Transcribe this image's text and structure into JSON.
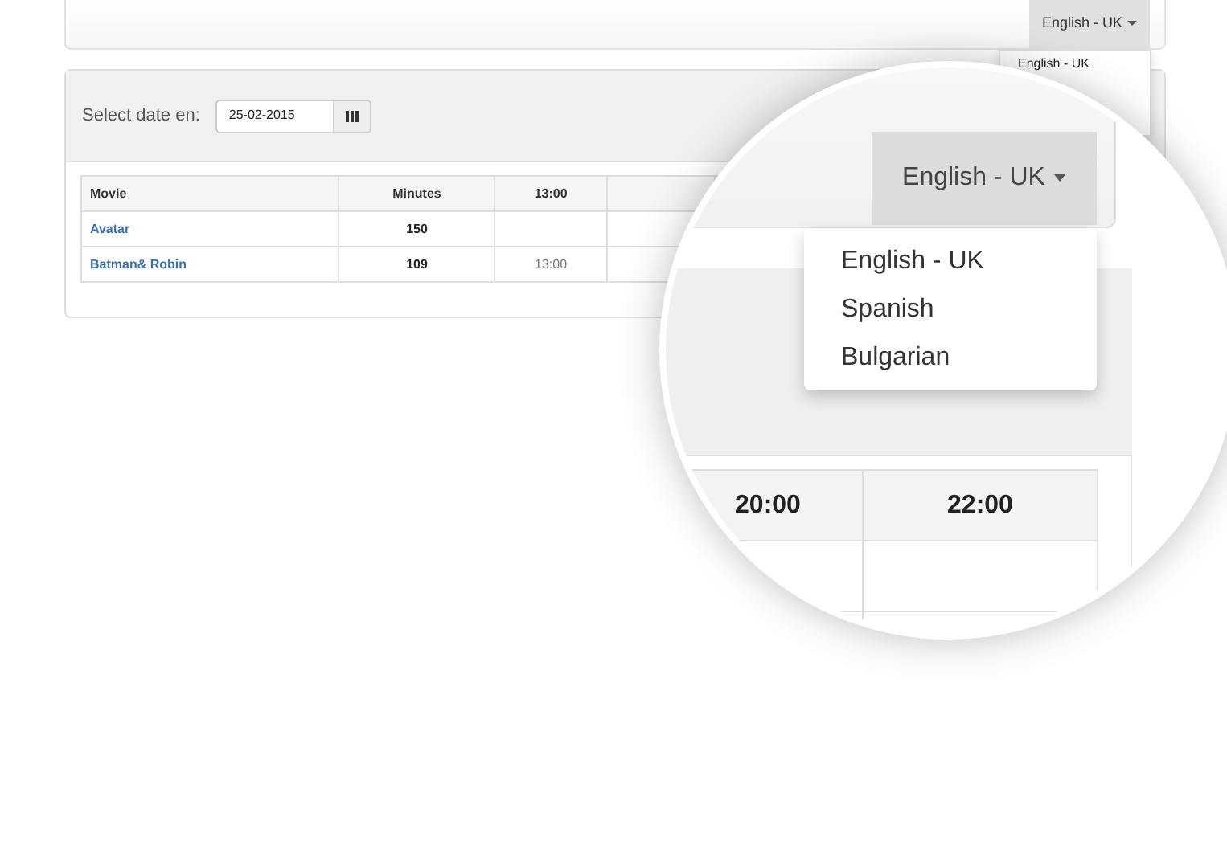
{
  "navbar": {
    "language_button": "English - UK",
    "dropdown_items": [
      "English - UK"
    ]
  },
  "date_picker": {
    "label": "Select date en:",
    "value": "25-02-2015"
  },
  "table": {
    "columns": [
      "Movie",
      "Minutes",
      "13:00"
    ],
    "rows": [
      {
        "cells": [
          "Avatar",
          "150"
        ]
      },
      {
        "cells": [
          "Batman& Robin",
          "109",
          "13:00"
        ]
      }
    ]
  },
  "magnifier": {
    "language_button": "English - UK",
    "menu_items": [
      "English - UK",
      "Spanish",
      "Bulgarian"
    ],
    "table_columns": [
      "20:00",
      "22:00"
    ]
  }
}
